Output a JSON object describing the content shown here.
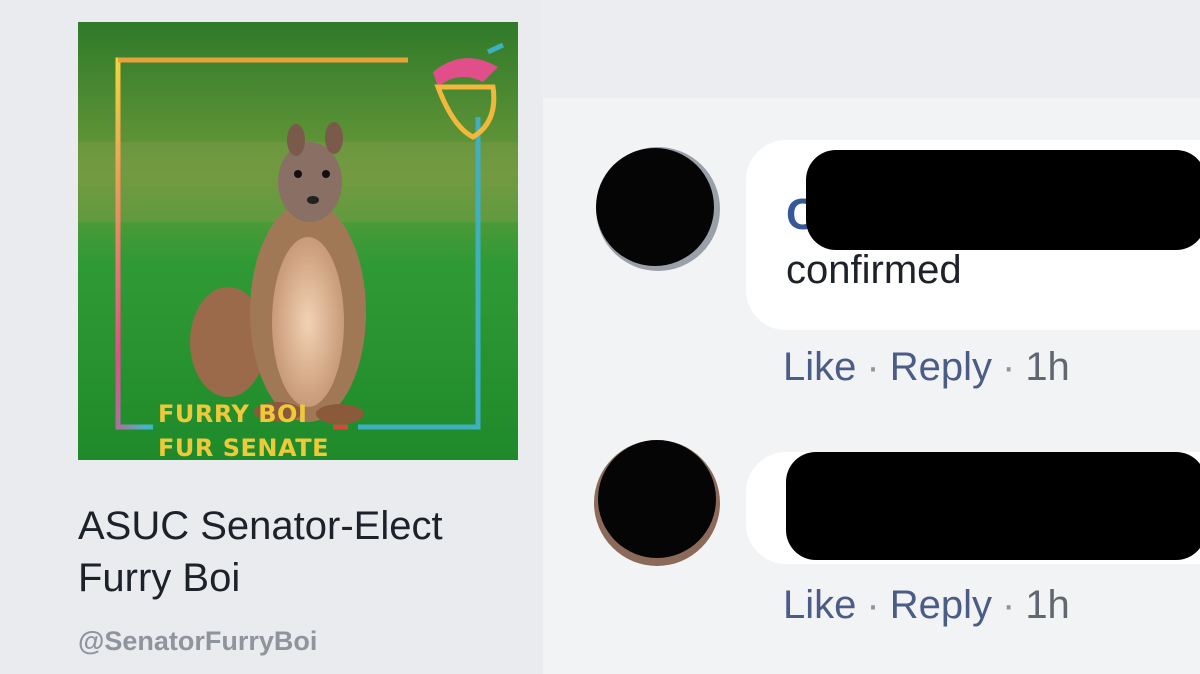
{
  "page": {
    "photo_caption_line1": "FURRY BOI",
    "photo_caption_line2": "FUR SENATE",
    "name": "ASUC Senator-Elect Furry Boi",
    "handle": "@SenatorFurryBoi"
  },
  "comments": [
    {
      "author_initial": "C",
      "text": "confirmed",
      "like_label": "Like",
      "reply_label": "Reply",
      "separator": "·",
      "time": "1h"
    },
    {
      "author_initial": "",
      "text": "",
      "like_label": "Like",
      "reply_label": "Reply",
      "separator": "·",
      "time": "1h"
    }
  ],
  "colors": {
    "link_blue": "#365899",
    "action_grey": "#4b5c86",
    "background": "#e9ebee",
    "redaction": "#000000"
  },
  "icons": {
    "photo_logo": "acorn-icon"
  }
}
